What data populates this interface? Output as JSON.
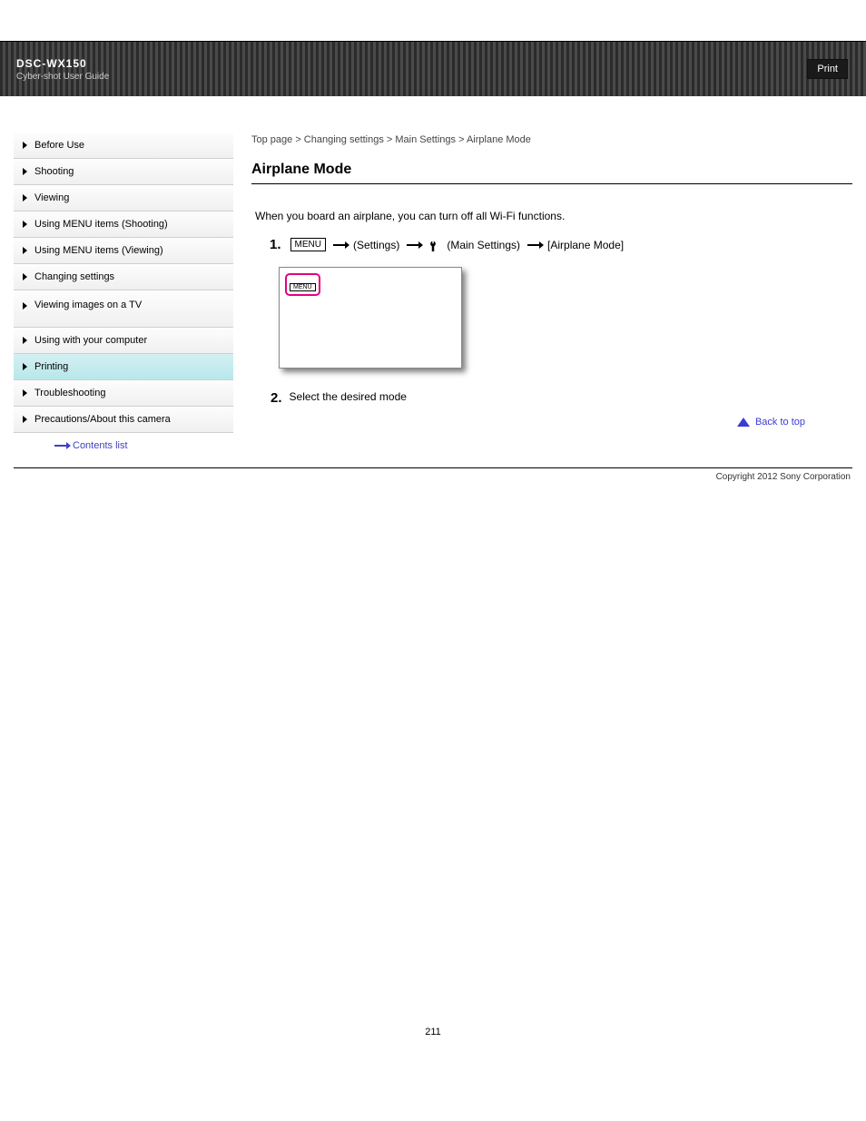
{
  "banner": {
    "brand": "DSC-WX150",
    "subtitle": "Cyber-shot User Guide",
    "print_label": "Print"
  },
  "breadcrumb": "Top page > Changing settings > Main Settings > Airplane Mode",
  "section_title": "Airplane Mode",
  "intro": "When you board an airplane, you can turn off all Wi-Fi functions.",
  "step1": {
    "menu_label": "MENU",
    "token1": "→",
    "text1": "(Settings)",
    "text2": "(Main Settings)",
    "text3": "[Airplane Mode]"
  },
  "step2": {
    "num": "2.",
    "text": "Select the desired mode"
  },
  "back_top": "Back to top",
  "copyright": "Copyright 2012 Sony Corporation",
  "page_number": "211",
  "sidebar": {
    "items": [
      {
        "label": "Before Use"
      },
      {
        "label": "Shooting"
      },
      {
        "label": "Viewing"
      },
      {
        "label": "Using MENU items (Shooting)"
      },
      {
        "label": "Using MENU items (Viewing)"
      },
      {
        "label": "Changing settings"
      },
      {
        "label": "Viewing images on a TV"
      },
      {
        "label": "Using with your computer"
      },
      {
        "label": "Printing"
      },
      {
        "label": "Troubleshooting"
      },
      {
        "label": "Precautions/About this camera"
      }
    ],
    "trademarks": "Contents list"
  }
}
